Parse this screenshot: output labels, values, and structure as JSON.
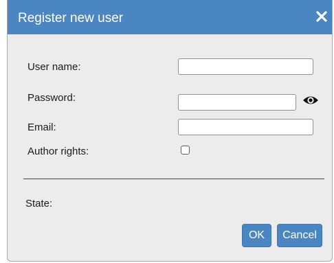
{
  "dialog": {
    "title": "Register new user",
    "close_icon": "close-icon",
    "title_bar_color": "#4a86c1"
  },
  "form": {
    "username": {
      "label": "User name:",
      "value": "",
      "placeholder": ""
    },
    "password": {
      "label": "Password:",
      "value": "",
      "placeholder": "",
      "reveal_icon": "eye-icon"
    },
    "email": {
      "label": "Email:",
      "value": "",
      "placeholder": ""
    },
    "author_rights": {
      "label": "Author rights:",
      "checked": false
    }
  },
  "state": {
    "label": "State:"
  },
  "buttons": {
    "ok_label": "OK",
    "cancel_label": "Cancel",
    "color": "#4a86c1"
  }
}
